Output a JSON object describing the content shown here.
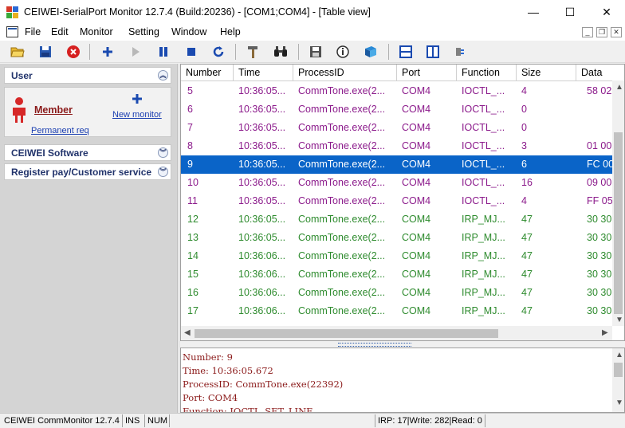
{
  "window": {
    "title": "CEIWEI-SerialPort Monitor 12.7.4  (Build:20236) - [COM1;COM4] - [Table view]",
    "minimize": "—",
    "maximize": "☐",
    "close": "✕"
  },
  "menu": [
    "File",
    "Edit",
    "Monitor",
    "Setting",
    "Window",
    "Help"
  ],
  "mdi": {
    "minimize": "_",
    "restore": "❐",
    "close": "✕"
  },
  "toolbar": [
    "open-folder-icon",
    "save-icon",
    "stop-red-icon",
    "add-icon",
    "play-icon",
    "pause-icon",
    "stop-icon",
    "refresh-icon",
    "tools-icon",
    "binoculars-icon",
    "floppy-export-icon",
    "info-icon",
    "book-icon",
    "split-horizontal-icon",
    "split-vertical-icon",
    "plugin-icon"
  ],
  "sidebar": {
    "user_title": "User",
    "member": "Member",
    "new_monitor": "New monitor",
    "permanent_req": "Permanent req",
    "software_title": "CEIWEI Software",
    "register_title": "Register pay/Customer service"
  },
  "table": {
    "columns": [
      "Number",
      "Time",
      "ProcessID",
      "Port",
      "Function",
      "Size",
      "Data"
    ],
    "rows": [
      {
        "number": "5",
        "time": "10:36:05...",
        "pid": "CommTone.exe(2...",
        "port": "COM4",
        "func": "IOCTL_...",
        "size": "4",
        "data": "58 02",
        "color": "#8b1a8b"
      },
      {
        "number": "6",
        "time": "10:36:05...",
        "pid": "CommTone.exe(2...",
        "port": "COM4",
        "func": "IOCTL_...",
        "size": "0",
        "data": "",
        "color": "#8b1a8b"
      },
      {
        "number": "7",
        "time": "10:36:05...",
        "pid": "CommTone.exe(2...",
        "port": "COM4",
        "func": "IOCTL_...",
        "size": "0",
        "data": "",
        "color": "#8b1a8b"
      },
      {
        "number": "8",
        "time": "10:36:05...",
        "pid": "CommTone.exe(2...",
        "port": "COM4",
        "func": "IOCTL_...",
        "size": "3",
        "data": "01 00",
        "color": "#8b1a8b"
      },
      {
        "number": "9",
        "time": "10:36:05...",
        "pid": "CommTone.exe(2...",
        "port": "COM4",
        "func": "IOCTL_...",
        "size": "6",
        "data": "FC 00",
        "color": "#8b1a8b",
        "selected": true
      },
      {
        "number": "10",
        "time": "10:36:05...",
        "pid": "CommTone.exe(2...",
        "port": "COM4",
        "func": "IOCTL_...",
        "size": "16",
        "data": "09 00",
        "color": "#8b1a8b"
      },
      {
        "number": "11",
        "time": "10:36:05...",
        "pid": "CommTone.exe(2...",
        "port": "COM4",
        "func": "IOCTL_...",
        "size": "4",
        "data": "FF 05",
        "color": "#8b1a8b"
      },
      {
        "number": "12",
        "time": "10:36:05...",
        "pid": "CommTone.exe(2...",
        "port": "COM4",
        "func": "IRP_MJ...",
        "size": "47",
        "data": "30 30",
        "color": "#2e8b2e"
      },
      {
        "number": "13",
        "time": "10:36:05...",
        "pid": "CommTone.exe(2...",
        "port": "COM4",
        "func": "IRP_MJ...",
        "size": "47",
        "data": "30 30",
        "color": "#2e8b2e"
      },
      {
        "number": "14",
        "time": "10:36:06...",
        "pid": "CommTone.exe(2...",
        "port": "COM4",
        "func": "IRP_MJ...",
        "size": "47",
        "data": "30 30",
        "color": "#2e8b2e"
      },
      {
        "number": "15",
        "time": "10:36:06...",
        "pid": "CommTone.exe(2...",
        "port": "COM4",
        "func": "IRP_MJ...",
        "size": "47",
        "data": "30 30",
        "color": "#2e8b2e"
      },
      {
        "number": "16",
        "time": "10:36:06...",
        "pid": "CommTone.exe(2...",
        "port": "COM4",
        "func": "IRP_MJ...",
        "size": "47",
        "data": "30 30",
        "color": "#2e8b2e"
      },
      {
        "number": "17",
        "time": "10:36:06...",
        "pid": "CommTone.exe(2...",
        "port": "COM4",
        "func": "IRP_MJ...",
        "size": "47",
        "data": "30 30",
        "color": "#2e8b2e"
      }
    ]
  },
  "detail": {
    "lines": [
      "Number: 9",
      "Time: 10:36:05.672",
      "ProcessID: CommTone.exe(22392)",
      "Port: COM4",
      "Function: IOCTL_SET_LINE..."
    ]
  },
  "status": {
    "app": "CEIWEI CommMonitor 12.7.4",
    "ins": "INS",
    "num": "NUM",
    "counts": "IRP: 17|Write: 282|Read: 0"
  }
}
